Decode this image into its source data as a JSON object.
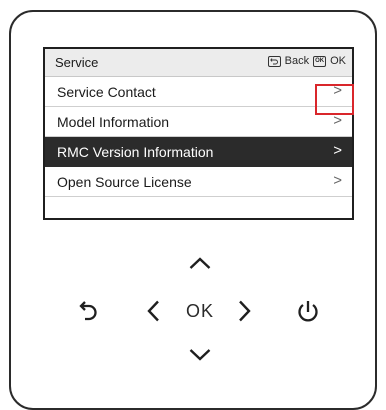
{
  "screen": {
    "title": "Service",
    "hints": [
      {
        "key": "back",
        "icon": "back-icon",
        "label": "Back"
      },
      {
        "key": "ok",
        "icon": "ok-key-icon",
        "glyph": "OK",
        "label": "OK"
      }
    ],
    "items": [
      {
        "label": "Service Contact",
        "selected": false
      },
      {
        "label": "Model Information",
        "selected": false
      },
      {
        "label": "RMC Version Information",
        "selected": true
      },
      {
        "label": "Open Source License",
        "selected": false
      }
    ],
    "chevron": ">"
  },
  "keypad": {
    "ok_label": "OK",
    "keys": [
      "up-arrow",
      "left-arrow",
      "ok",
      "right-arrow",
      "down-arrow",
      "back",
      "power"
    ]
  },
  "colors": {
    "selected_bg": "#2b2b2b",
    "header_bg": "#ececec",
    "highlight": "#d9262b"
  }
}
